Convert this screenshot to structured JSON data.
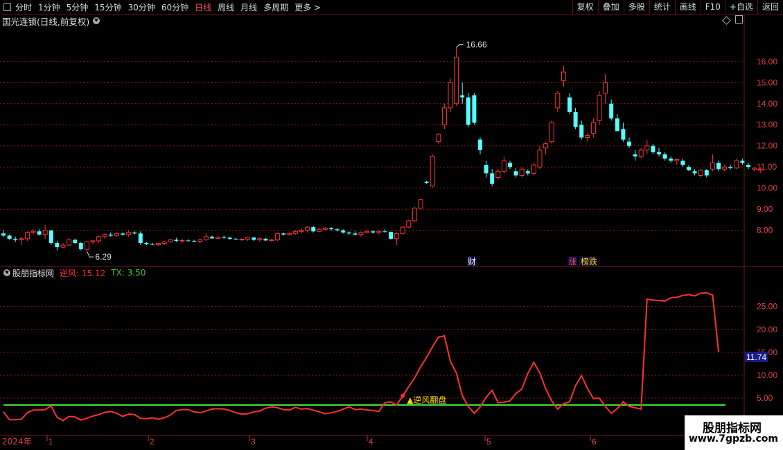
{
  "toolbar": {
    "periods": [
      "分时",
      "1分钟",
      "5分钟",
      "15分钟",
      "30分钟",
      "60分钟",
      "日线",
      "周线",
      "月线",
      "多周期",
      "更多 >"
    ],
    "active_period": "日线",
    "right_buttons": [
      "复权",
      "叠加",
      "多股",
      "统计",
      "画线",
      "F10",
      "+自选",
      "返回"
    ]
  },
  "chart_title": "国光连锁(日线,前复权)",
  "price_axis": [
    "16.00",
    "15.00",
    "14.00",
    "13.00",
    "12.00",
    "11.00",
    "10.00",
    "9.00",
    "8.00"
  ],
  "max_label": "16.66",
  "min_label": "6.29",
  "tags": {
    "cai": "财",
    "zhang": "涨",
    "bangdie": "榜跌"
  },
  "indicator": {
    "name": "股朋指标网",
    "line1": "逆风: 15.12",
    "line2": "TX: 3.50",
    "signal": "▲逆风翻盘",
    "current": "11.74"
  },
  "ind_axis": [
    "25.00",
    "20.00",
    "15.00",
    "10.00",
    "5.00"
  ],
  "date_axis": {
    "year": "2024年",
    "months": [
      "1",
      "2",
      "3",
      "4",
      "5",
      "6"
    ]
  },
  "watermark": {
    "title": "股朋指标网",
    "url": "www.7gpzb.com"
  },
  "colors": {
    "up": "#ff3232",
    "down": "#54ffff",
    "grid": "#8a1a1a",
    "threshold": "#40e040",
    "current_bg": "#1a1a8a"
  },
  "chart_data": {
    "type": "candlestick",
    "title": "国光连锁(日线,前复权)",
    "ylim": [
      7.3,
      17.0
    ],
    "candles": [
      [
        7.85,
        8.0,
        7.7,
        7.75
      ],
      [
        7.75,
        7.8,
        7.55,
        7.6
      ],
      [
        7.6,
        7.7,
        7.45,
        7.55
      ],
      [
        7.55,
        7.7,
        7.3,
        7.6
      ],
      [
        7.6,
        7.95,
        7.5,
        7.9
      ],
      [
        7.9,
        8.05,
        7.8,
        7.95
      ],
      [
        7.95,
        8.05,
        7.75,
        7.8
      ],
      [
        7.8,
        8.25,
        7.6,
        8.0
      ],
      [
        8.0,
        8.0,
        7.3,
        7.4
      ],
      [
        7.4,
        7.5,
        7.05,
        7.2
      ],
      [
        7.2,
        7.4,
        7.15,
        7.3
      ],
      [
        7.3,
        7.65,
        7.25,
        7.55
      ],
      [
        7.55,
        7.6,
        7.35,
        7.4
      ],
      [
        7.4,
        7.45,
        7.05,
        7.1
      ],
      [
        7.1,
        7.5,
        7.0,
        7.45
      ],
      [
        7.45,
        7.55,
        7.35,
        7.5
      ],
      [
        7.5,
        7.75,
        7.4,
        7.7
      ],
      [
        7.7,
        7.85,
        7.6,
        7.8
      ],
      [
        7.8,
        7.9,
        7.7,
        7.75
      ],
      [
        7.75,
        7.9,
        7.7,
        7.85
      ],
      [
        7.85,
        7.9,
        7.75,
        7.8
      ],
      [
        7.8,
        8.0,
        7.7,
        7.9
      ],
      [
        7.9,
        7.95,
        7.8,
        7.85
      ],
      [
        7.85,
        7.95,
        7.3,
        7.4
      ],
      [
        7.4,
        7.45,
        7.3,
        7.35
      ],
      [
        7.35,
        7.4,
        7.3,
        7.32
      ],
      [
        7.32,
        7.4,
        7.25,
        7.38
      ],
      [
        7.38,
        7.5,
        7.3,
        7.45
      ],
      [
        7.45,
        7.6,
        7.4,
        7.55
      ],
      [
        7.55,
        7.65,
        7.45,
        7.5
      ],
      [
        7.5,
        7.6,
        7.45,
        7.52
      ],
      [
        7.52,
        7.58,
        7.48,
        7.5
      ],
      [
        7.5,
        7.55,
        7.45,
        7.48
      ],
      [
        7.48,
        7.6,
        7.4,
        7.55
      ],
      [
        7.55,
        7.85,
        7.5,
        7.7
      ],
      [
        7.7,
        7.75,
        7.6,
        7.62
      ],
      [
        7.62,
        7.72,
        7.58,
        7.68
      ],
      [
        7.68,
        7.75,
        7.6,
        7.65
      ],
      [
        7.65,
        7.7,
        7.55,
        7.6
      ],
      [
        7.6,
        7.65,
        7.55,
        7.57
      ],
      [
        7.57,
        7.62,
        7.5,
        7.58
      ],
      [
        7.58,
        7.7,
        7.5,
        7.66
      ],
      [
        7.66,
        7.7,
        7.5,
        7.55
      ],
      [
        7.55,
        7.65,
        7.45,
        7.6
      ],
      [
        7.6,
        7.65,
        7.5,
        7.52
      ],
      [
        7.52,
        7.6,
        7.45,
        7.55
      ],
      [
        7.55,
        7.9,
        7.5,
        7.85
      ],
      [
        7.85,
        7.9,
        7.75,
        7.8
      ],
      [
        7.8,
        7.9,
        7.75,
        7.85
      ],
      [
        7.85,
        8.0,
        7.8,
        7.95
      ],
      [
        7.95,
        8.1,
        7.85,
        8.0
      ],
      [
        8.0,
        8.2,
        7.9,
        8.15
      ],
      [
        8.15,
        8.2,
        7.9,
        7.95
      ],
      [
        7.95,
        8.1,
        7.9,
        8.05
      ],
      [
        8.05,
        8.15,
        8.0,
        8.1
      ],
      [
        8.1,
        8.15,
        8.0,
        8.05
      ],
      [
        8.05,
        8.1,
        7.95,
        8.0
      ],
      [
        8.0,
        8.05,
        7.85,
        7.9
      ],
      [
        7.9,
        7.95,
        7.8,
        7.85
      ],
      [
        7.85,
        7.95,
        7.75,
        7.8
      ],
      [
        7.8,
        7.95,
        7.7,
        7.9
      ],
      [
        7.9,
        8.0,
        7.85,
        7.95
      ],
      [
        7.95,
        8.0,
        7.85,
        7.9
      ],
      [
        7.9,
        8.0,
        7.8,
        7.95
      ],
      [
        7.95,
        8.05,
        7.9,
        7.92
      ],
      [
        7.92,
        7.95,
        7.55,
        7.6
      ],
      [
        7.6,
        7.9,
        7.3,
        7.85
      ],
      [
        7.85,
        8.2,
        7.8,
        8.15
      ],
      [
        8.15,
        8.5,
        8.1,
        8.45
      ],
      [
        8.45,
        9.1,
        8.4,
        9.05
      ],
      [
        9.05,
        9.5,
        9.0,
        9.45
      ],
      [
        10.3,
        10.35,
        10.2,
        10.25
      ],
      [
        10.1,
        11.6,
        10.0,
        11.5
      ],
      [
        12.2,
        12.6,
        12.1,
        12.55
      ],
      [
        13.0,
        14.0,
        12.8,
        13.8
      ],
      [
        13.8,
        15.2,
        13.6,
        15.0
      ],
      [
        14.0,
        16.66,
        13.9,
        16.2
      ],
      [
        14.4,
        15.0,
        14.0,
        14.3
      ],
      [
        14.3,
        14.5,
        12.9,
        13.0
      ],
      [
        14.4,
        14.5,
        13.0,
        13.1
      ],
      [
        12.3,
        12.4,
        11.6,
        11.8
      ],
      [
        11.1,
        11.3,
        10.5,
        10.7
      ],
      [
        10.7,
        10.9,
        10.1,
        10.2
      ],
      [
        10.5,
        10.9,
        10.4,
        10.8
      ],
      [
        10.8,
        11.5,
        10.7,
        11.3
      ],
      [
        11.2,
        11.3,
        10.9,
        11.0
      ],
      [
        10.8,
        10.95,
        10.5,
        10.6
      ],
      [
        10.6,
        11.0,
        10.5,
        10.9
      ],
      [
        10.8,
        10.9,
        10.6,
        10.7
      ],
      [
        10.7,
        11.2,
        10.6,
        11.1
      ],
      [
        11.0,
        12.0,
        10.9,
        11.8
      ],
      [
        11.9,
        12.2,
        11.6,
        12.1
      ],
      [
        12.2,
        13.2,
        12.1,
        13.1
      ],
      [
        13.8,
        14.6,
        13.6,
        14.5
      ],
      [
        15.1,
        15.8,
        14.8,
        15.5
      ],
      [
        14.3,
        14.5,
        13.5,
        13.6
      ],
      [
        13.6,
        13.8,
        12.8,
        12.9
      ],
      [
        13.0,
        13.2,
        12.3,
        12.4
      ],
      [
        12.4,
        12.6,
        12.2,
        12.5
      ],
      [
        12.6,
        13.3,
        12.4,
        13.1
      ],
      [
        13.2,
        14.6,
        13.0,
        14.4
      ],
      [
        14.5,
        15.4,
        14.0,
        15.0
      ],
      [
        14.0,
        14.2,
        13.2,
        13.3
      ],
      [
        13.3,
        13.5,
        12.8,
        12.7
      ],
      [
        12.8,
        13.1,
        12.2,
        12.3
      ],
      [
        12.2,
        12.4,
        11.9,
        12.0
      ],
      [
        11.6,
        11.8,
        11.3,
        11.5
      ],
      [
        11.5,
        11.9,
        11.4,
        11.8
      ],
      [
        11.8,
        12.3,
        11.6,
        12.0
      ],
      [
        12.0,
        12.1,
        11.6,
        11.7
      ],
      [
        11.7,
        11.9,
        11.5,
        11.6
      ],
      [
        11.6,
        11.7,
        11.3,
        11.4
      ],
      [
        11.4,
        11.5,
        11.2,
        11.3
      ],
      [
        11.3,
        11.4,
        11.1,
        11.35
      ],
      [
        11.3,
        11.4,
        11.0,
        11.1
      ],
      [
        11.0,
        11.1,
        10.8,
        10.85
      ],
      [
        10.8,
        10.9,
        10.6,
        10.7
      ],
      [
        10.6,
        10.9,
        10.5,
        10.85
      ],
      [
        10.85,
        10.9,
        10.5,
        10.6
      ],
      [
        10.9,
        11.6,
        10.8,
        11.2
      ],
      [
        11.2,
        11.3,
        10.8,
        10.9
      ],
      [
        10.9,
        11.1,
        10.8,
        11.0
      ],
      [
        11.0,
        11.1,
        10.9,
        10.95
      ],
      [
        10.95,
        11.4,
        10.9,
        11.3
      ],
      [
        11.3,
        11.4,
        11.1,
        11.2
      ],
      [
        11.1,
        11.2,
        10.9,
        11.0
      ],
      [
        10.9,
        11.0,
        10.8,
        10.95
      ],
      [
        10.85,
        11.0,
        10.7,
        10.9
      ]
    ],
    "indicator_series": [
      {
        "name": "逆风",
        "values": [
          2.0,
          0.3,
          0.3,
          0.4,
          1.8,
          2.4,
          2.4,
          2.5,
          3.3,
          0.8,
          0.1,
          1.0,
          0.9,
          0.2,
          0.6,
          1.1,
          1.4,
          1.9,
          2.1,
          1.7,
          1.0,
          1.5,
          1.4,
          0.6,
          0.5,
          0.7,
          0.4,
          0.7,
          1.3,
          2.3,
          2.5,
          2.5,
          2.0,
          1.8,
          2.2,
          2.6,
          2.7,
          2.6,
          2.3,
          1.8,
          1.5,
          1.6,
          2.0,
          2.2,
          2.8,
          3.1,
          2.9,
          2.5,
          2.4,
          3.0,
          2.6,
          2.7,
          2.4,
          2.0,
          1.6,
          1.8,
          2.1,
          2.6,
          3.1,
          2.5,
          2.6,
          2.4,
          2.3,
          2.1,
          4.0,
          4.2,
          3.5,
          5.5,
          7.5,
          9.4,
          11.8,
          13.9,
          16.2,
          18.3,
          18.6,
          13.0,
          10.5,
          5.5,
          3.2,
          1.7,
          3.1,
          5.2,
          6.7,
          4.0,
          4.1,
          4.4,
          6.0,
          7.0,
          10.4,
          12.8,
          10.5,
          7.0,
          4.4,
          2.6,
          3.8,
          4.2,
          7.7,
          9.9,
          7.1,
          4.9,
          5.0,
          3.2,
          1.7,
          2.7,
          4.2,
          3.2,
          2.9,
          2.6,
          26.6,
          26.4,
          26.3,
          26.2,
          26.9,
          27.0,
          27.4,
          27.6,
          27.3,
          27.9,
          28.0,
          27.5,
          15.12
        ]
      },
      {
        "name": "TX",
        "values": [
          3.5
        ]
      }
    ],
    "ind_ylim": [
      -3.5,
      30.5
    ],
    "indicator_ticks": [
      5,
      10,
      15,
      20,
      25
    ]
  }
}
